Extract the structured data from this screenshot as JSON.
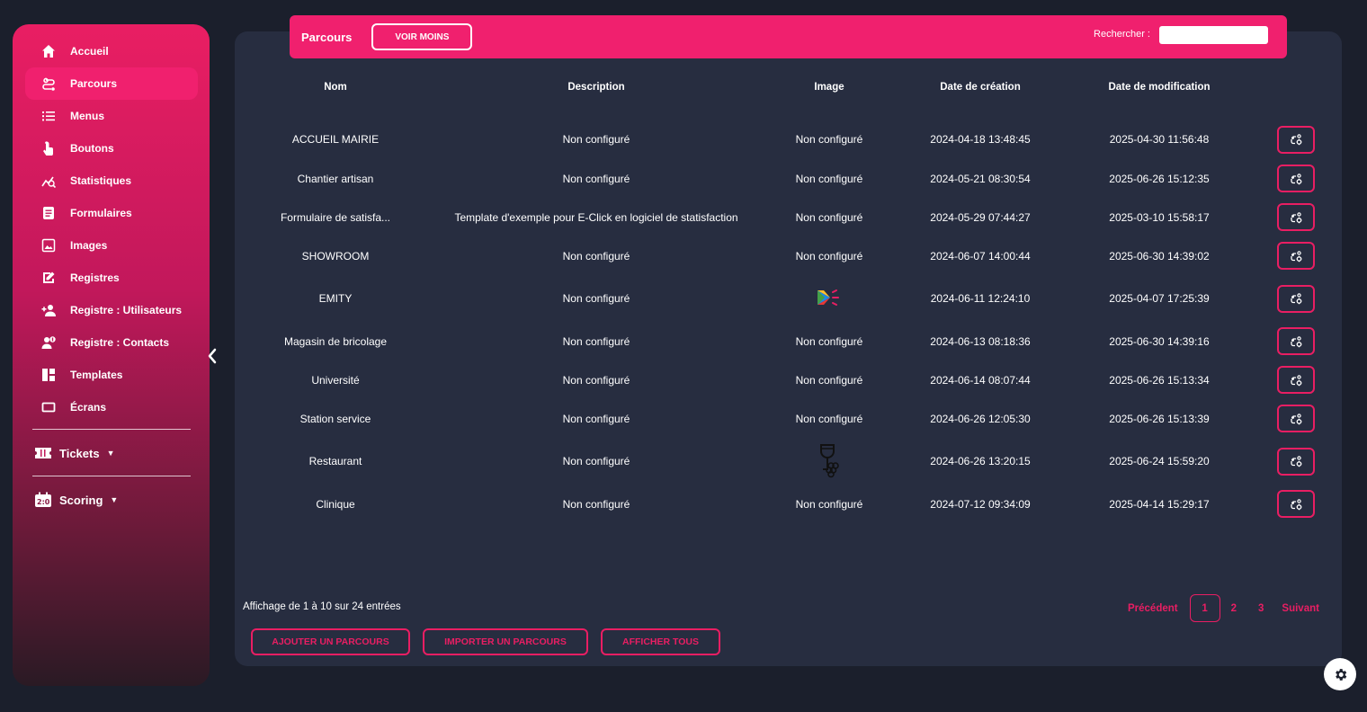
{
  "sidebar": {
    "items": [
      {
        "label": "Accueil",
        "icon": "home-icon"
      },
      {
        "label": "Parcours",
        "icon": "route-icon",
        "active": true
      },
      {
        "label": "Menus",
        "icon": "list-icon"
      },
      {
        "label": "Boutons",
        "icon": "pointer-icon"
      },
      {
        "label": "Statistiques",
        "icon": "chart-icon"
      },
      {
        "label": "Formulaires",
        "icon": "form-icon"
      },
      {
        "label": "Images",
        "icon": "image-icon"
      },
      {
        "label": "Registres",
        "icon": "edit-icon"
      },
      {
        "label": "Registre : Utilisateurs",
        "icon": "user-add-icon"
      },
      {
        "label": "Registre : Contacts",
        "icon": "contact-icon"
      },
      {
        "label": "Templates",
        "icon": "dashboard-icon"
      },
      {
        "label": "Écrans",
        "icon": "screen-icon"
      }
    ],
    "groups": [
      {
        "label": "Tickets",
        "icon": "ticket-icon"
      },
      {
        "label": "Scoring",
        "icon": "scoreboard-icon"
      }
    ]
  },
  "topbar": {
    "title": "Parcours",
    "toggle_label": "VOIR MOINS",
    "search_label": "Rechercher :",
    "search_value": ""
  },
  "table": {
    "headers": {
      "nom": "Nom",
      "description": "Description",
      "image": "Image",
      "date_creation": "Date de création",
      "date_modification": "Date de modification"
    },
    "rows": [
      {
        "nom": "ACCUEIL MAIRIE",
        "description": "Non configuré",
        "desc_configured": false,
        "image": "Non configuré",
        "image_icon": "",
        "date_creation": "2024-04-18 13:48:45",
        "date_modification": "2025-04-30 11:56:48"
      },
      {
        "nom": "Chantier artisan",
        "description": "Non configuré",
        "desc_configured": false,
        "image": "Non configuré",
        "image_icon": "",
        "date_creation": "2024-05-21 08:30:54",
        "date_modification": "2025-06-26 15:12:35"
      },
      {
        "nom": "Formulaire de satisfa...",
        "description": "Template d'exemple pour E-Click en logiciel de statisfaction",
        "desc_configured": true,
        "image": "Non configuré",
        "image_icon": "",
        "date_creation": "2024-05-29 07:44:27",
        "date_modification": "2025-03-10 15:58:17"
      },
      {
        "nom": "SHOWROOM",
        "description": "Non configuré",
        "desc_configured": false,
        "image": "Non configuré",
        "image_icon": "",
        "date_creation": "2024-06-07 14:00:44",
        "date_modification": "2025-06-30 14:39:02"
      },
      {
        "nom": "EMITY",
        "description": "Non configuré",
        "desc_configured": false,
        "image": "",
        "image_icon": "emity-logo-icon",
        "date_creation": "2024-06-11 12:24:10",
        "date_modification": "2025-04-07 17:25:39"
      },
      {
        "nom": "Magasin de bricolage",
        "description": "Non configuré",
        "desc_configured": false,
        "image": "Non configuré",
        "image_icon": "",
        "date_creation": "2024-06-13 08:18:36",
        "date_modification": "2025-06-30 14:39:16"
      },
      {
        "nom": "Université",
        "description": "Non configuré",
        "desc_configured": false,
        "image": "Non configuré",
        "image_icon": "",
        "date_creation": "2024-06-14 08:07:44",
        "date_modification": "2025-06-26 15:13:34"
      },
      {
        "nom": "Station service",
        "description": "Non configuré",
        "desc_configured": false,
        "image": "Non configuré",
        "image_icon": "",
        "date_creation": "2024-06-26 12:05:30",
        "date_modification": "2025-06-26 15:13:39"
      },
      {
        "nom": "Restaurant",
        "description": "Non configuré",
        "desc_configured": false,
        "image": "",
        "image_icon": "wine-grapes-icon",
        "date_creation": "2024-06-26 13:20:15",
        "date_modification": "2025-06-24 15:59:20"
      },
      {
        "nom": "Clinique",
        "description": "Non configuré",
        "desc_configured": false,
        "image": "Non configuré",
        "image_icon": "",
        "date_creation": "2024-07-12 09:34:09",
        "date_modification": "2025-04-14 15:29:17"
      }
    ]
  },
  "footer": {
    "info": "Affichage de 1 à 10 sur 24 entrées",
    "pagination": {
      "previous": "Précédent",
      "pages": [
        "1",
        "2",
        "3"
      ],
      "current": "1",
      "next": "Suivant"
    },
    "buttons": {
      "add": "AJOUTER UN PARCOURS",
      "import": "IMPORTER UN PARCOURS",
      "show_all": "AFFICHER TOUS"
    }
  },
  "colors": {
    "accent": "#e91e63",
    "topbar": "#f0206e",
    "background": "#1b1f2c",
    "panel": "#272d40"
  }
}
